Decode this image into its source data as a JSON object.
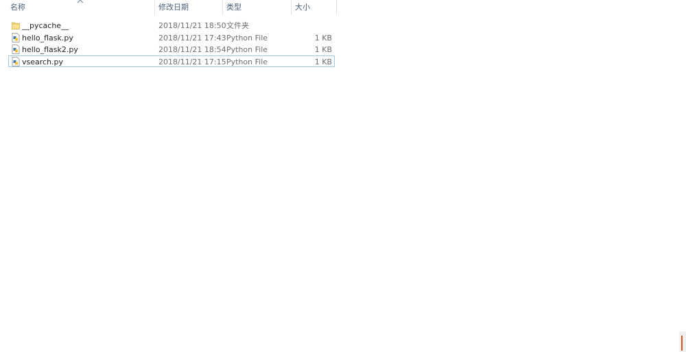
{
  "columns": {
    "name": "名称",
    "date": "修改日期",
    "type": "类型",
    "size": "大小"
  },
  "sort": {
    "column": "name",
    "direction": "ascending",
    "icon": "chevron-up-icon"
  },
  "files": [
    {
      "name": "__pycache__",
      "date": "2018/11/21 18:50",
      "type": "文件夹",
      "size": "",
      "icon": "folder-icon"
    },
    {
      "name": "hello_flask.py",
      "date": "2018/11/21 17:43",
      "type": "Python File",
      "size": "1 KB",
      "icon": "python-file-icon"
    },
    {
      "name": "hello_flask2.py",
      "date": "2018/11/21 18:54",
      "type": "Python File",
      "size": "1 KB",
      "icon": "python-file-icon"
    },
    {
      "name": "vsearch.py",
      "date": "2018/11/21 17:15",
      "type": "Python File",
      "size": "1 KB",
      "icon": "python-file-icon"
    }
  ],
  "focused_row": 3,
  "colors": {
    "header_text": "#4c607a",
    "focus_border": "#99c9ef",
    "folder": "#f7d774",
    "scroll_accent": "#d9531e"
  }
}
